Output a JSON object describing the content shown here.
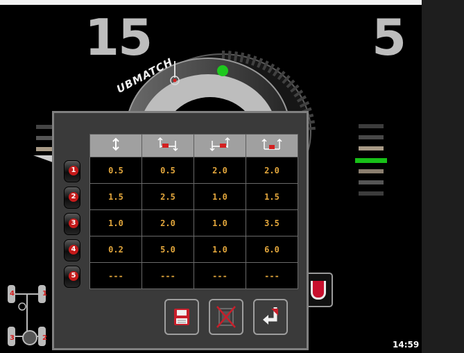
{
  "display": {
    "left_value": "15",
    "right_value": "5",
    "clock": "14:59",
    "wheel_brand_text": "UBMATCH"
  },
  "colors": {
    "background": "#000000",
    "dialog_bg": "#3a3a3a",
    "value_text": "#e2a63c",
    "row_badge": "#c41a1a",
    "ok_indicator": "#18c018"
  },
  "tolerance_table": {
    "header_icons": [
      "vertical-runout-icon",
      "lateral-runout-icon",
      "lateral-runout-alt-icon",
      "radial-runout-icon"
    ],
    "rows": [
      {
        "number": "1",
        "values": [
          "0.5",
          "0.5",
          "2.0",
          "2.0"
        ]
      },
      {
        "number": "2",
        "values": [
          "1.5",
          "2.5",
          "1.0",
          "1.5"
        ]
      },
      {
        "number": "3",
        "values": [
          "1.0",
          "2.0",
          "1.0",
          "3.5"
        ]
      },
      {
        "number": "4",
        "values": [
          "0.2",
          "5.0",
          "1.0",
          "6.0"
        ]
      },
      {
        "number": "5",
        "values": [
          "---",
          "---",
          "---",
          "---"
        ]
      }
    ]
  },
  "actions": [
    {
      "name": "save-button",
      "icon": "floppy-disk-icon"
    },
    {
      "name": "delete-button",
      "icon": "cross-out-icon"
    },
    {
      "name": "confirm-button",
      "icon": "enter-arrow-icon"
    }
  ],
  "axle_diagram": {
    "labels": [
      "4",
      "1",
      "3",
      "2"
    ]
  }
}
